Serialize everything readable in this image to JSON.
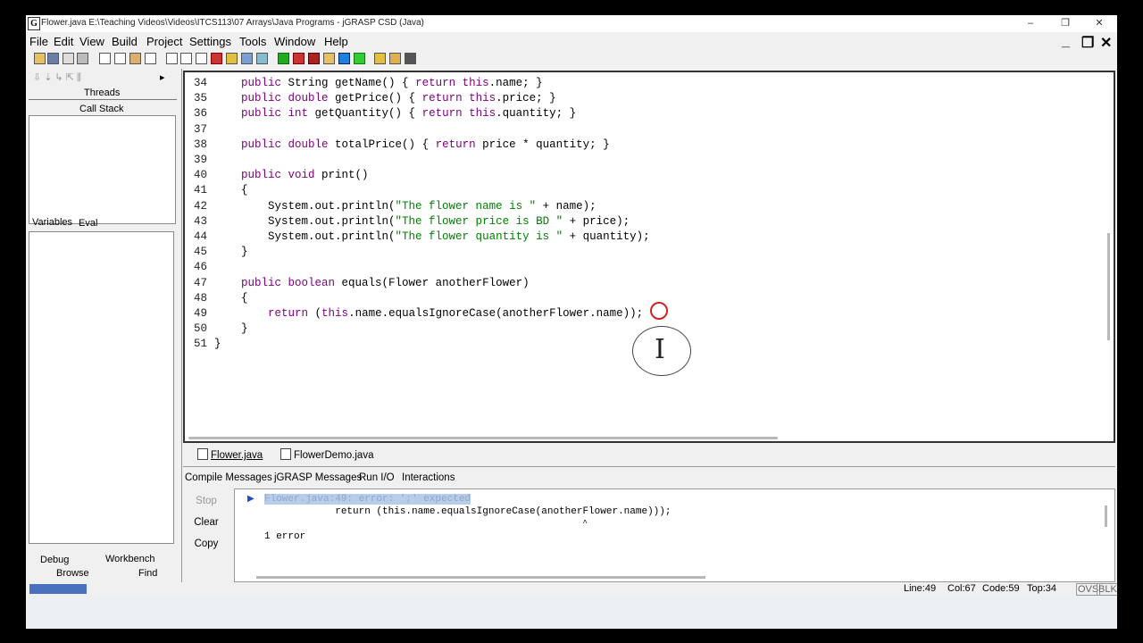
{
  "window": {
    "app_icon": "G",
    "title": "Flower.java  E:\\Teaching Videos\\Videos\\ITCS113\\07 Arrays\\Java Programs - jGRASP CSD (Java)",
    "controls": {
      "minimize": "–",
      "restore": "❐",
      "close": "✕"
    }
  },
  "menu": {
    "items": [
      "File",
      "Edit",
      "View",
      "Build",
      "Project",
      "Settings",
      "Tools",
      "Window",
      "Help"
    ],
    "mdi": {
      "minimize": "_",
      "restore": "❐",
      "close": "✕"
    }
  },
  "toolbar": {
    "icons": [
      "open-folder-icon",
      "save-icon",
      "browse-icon",
      "print-icon",
      "cut-icon",
      "copy-icon",
      "paste-icon",
      "undo-icon",
      "new-file-icon",
      "new-file-icon",
      "new-file-icon",
      "pin-icon",
      "chart-icon",
      "uml-icon",
      "book-icon",
      "add-icon",
      "run-icon",
      "debug-icon",
      "step-icon",
      "blue-square-icon",
      "green-square-icon",
      "checklist-icon",
      "mail-icon",
      "document-icon"
    ]
  },
  "left_panel": {
    "threads_label": "Threads",
    "call_stack_label": "Call Stack",
    "tabs": {
      "variables": "Variables",
      "eval": "Eval"
    },
    "bottom_tabs": {
      "debug": "Debug",
      "workbench": "Workbench",
      "browse": "Browse",
      "find": "Find"
    }
  },
  "editor": {
    "lines": [
      {
        "n": "34",
        "t": [
          {
            "k": "p",
            "v": "    "
          },
          {
            "k": "kw",
            "v": "public"
          },
          {
            "k": "p",
            "v": " String getName() { "
          },
          {
            "k": "kw",
            "v": "return"
          },
          {
            "k": "p",
            "v": " "
          },
          {
            "k": "kw",
            "v": "this"
          },
          {
            "k": "p",
            "v": ".name; }"
          }
        ]
      },
      {
        "n": "35",
        "t": [
          {
            "k": "p",
            "v": "    "
          },
          {
            "k": "kw",
            "v": "public double"
          },
          {
            "k": "p",
            "v": " getPrice() { "
          },
          {
            "k": "kw",
            "v": "return"
          },
          {
            "k": "p",
            "v": " "
          },
          {
            "k": "kw",
            "v": "this"
          },
          {
            "k": "p",
            "v": ".price; }"
          }
        ]
      },
      {
        "n": "36",
        "t": [
          {
            "k": "p",
            "v": "    "
          },
          {
            "k": "kw",
            "v": "public int"
          },
          {
            "k": "p",
            "v": " getQuantity() { "
          },
          {
            "k": "kw",
            "v": "return"
          },
          {
            "k": "p",
            "v": " "
          },
          {
            "k": "kw",
            "v": "this"
          },
          {
            "k": "p",
            "v": ".quantity; }"
          }
        ]
      },
      {
        "n": "37",
        "t": []
      },
      {
        "n": "38",
        "t": [
          {
            "k": "p",
            "v": "    "
          },
          {
            "k": "kw",
            "v": "public double"
          },
          {
            "k": "p",
            "v": " totalPrice() { "
          },
          {
            "k": "kw",
            "v": "return"
          },
          {
            "k": "p",
            "v": " price * quantity; }"
          }
        ]
      },
      {
        "n": "39",
        "t": []
      },
      {
        "n": "40",
        "t": [
          {
            "k": "p",
            "v": "    "
          },
          {
            "k": "kw",
            "v": "public void"
          },
          {
            "k": "p",
            "v": " print()"
          }
        ]
      },
      {
        "n": "41",
        "t": [
          {
            "k": "p",
            "v": "    {"
          }
        ]
      },
      {
        "n": "42",
        "t": [
          {
            "k": "p",
            "v": "        System.out.println("
          },
          {
            "k": "str",
            "v": "\"The flower name is \""
          },
          {
            "k": "p",
            "v": " + name);"
          }
        ]
      },
      {
        "n": "43",
        "t": [
          {
            "k": "p",
            "v": "        System.out.println("
          },
          {
            "k": "str",
            "v": "\"The flower price is BD \""
          },
          {
            "k": "p",
            "v": " + price);"
          }
        ]
      },
      {
        "n": "44",
        "t": [
          {
            "k": "p",
            "v": "        System.out.println("
          },
          {
            "k": "str",
            "v": "\"The flower quantity is \""
          },
          {
            "k": "p",
            "v": " + quantity);"
          }
        ]
      },
      {
        "n": "45",
        "t": [
          {
            "k": "p",
            "v": "    }"
          }
        ]
      },
      {
        "n": "46",
        "t": []
      },
      {
        "n": "47",
        "t": [
          {
            "k": "p",
            "v": "    "
          },
          {
            "k": "kw",
            "v": "public boolean"
          },
          {
            "k": "p",
            "v": " equals(Flower anotherFlower)"
          }
        ]
      },
      {
        "n": "48",
        "t": [
          {
            "k": "p",
            "v": "    {"
          }
        ]
      },
      {
        "n": "49",
        "t": [
          {
            "k": "p",
            "v": "        "
          },
          {
            "k": "kw",
            "v": "return"
          },
          {
            "k": "p",
            "v": " ("
          },
          {
            "k": "kw",
            "v": "this"
          },
          {
            "k": "p",
            "v": ".name.equalsIgnoreCase(anotherFlower.name));"
          }
        ]
      },
      {
        "n": "50",
        "t": [
          {
            "k": "p",
            "v": "    }"
          }
        ]
      },
      {
        "n": "51",
        "t": [
          {
            "k": "p",
            "v": "}"
          }
        ]
      }
    ]
  },
  "file_tabs": [
    "Flower.java",
    "FlowerDemo.java"
  ],
  "messages": {
    "tabs": [
      "Compile Messages",
      "jGRASP Messages",
      "Run I/O",
      "Interactions"
    ],
    "buttons": {
      "stop": "Stop",
      "clear": "Clear",
      "copy": "Copy"
    },
    "error_line": "Flower.java:49: error: ';' expected",
    "code_line": "            return (this.name.equalsIgnoreCase(anotherFlower.name)));",
    "caret_line": "                                                                  ^",
    "summary": "1 error"
  },
  "status": {
    "line": "Line:49",
    "col": "Col:67",
    "code": "Code:59",
    "top": "Top:34",
    "ovs": "OVS",
    "blk": "BLK"
  }
}
